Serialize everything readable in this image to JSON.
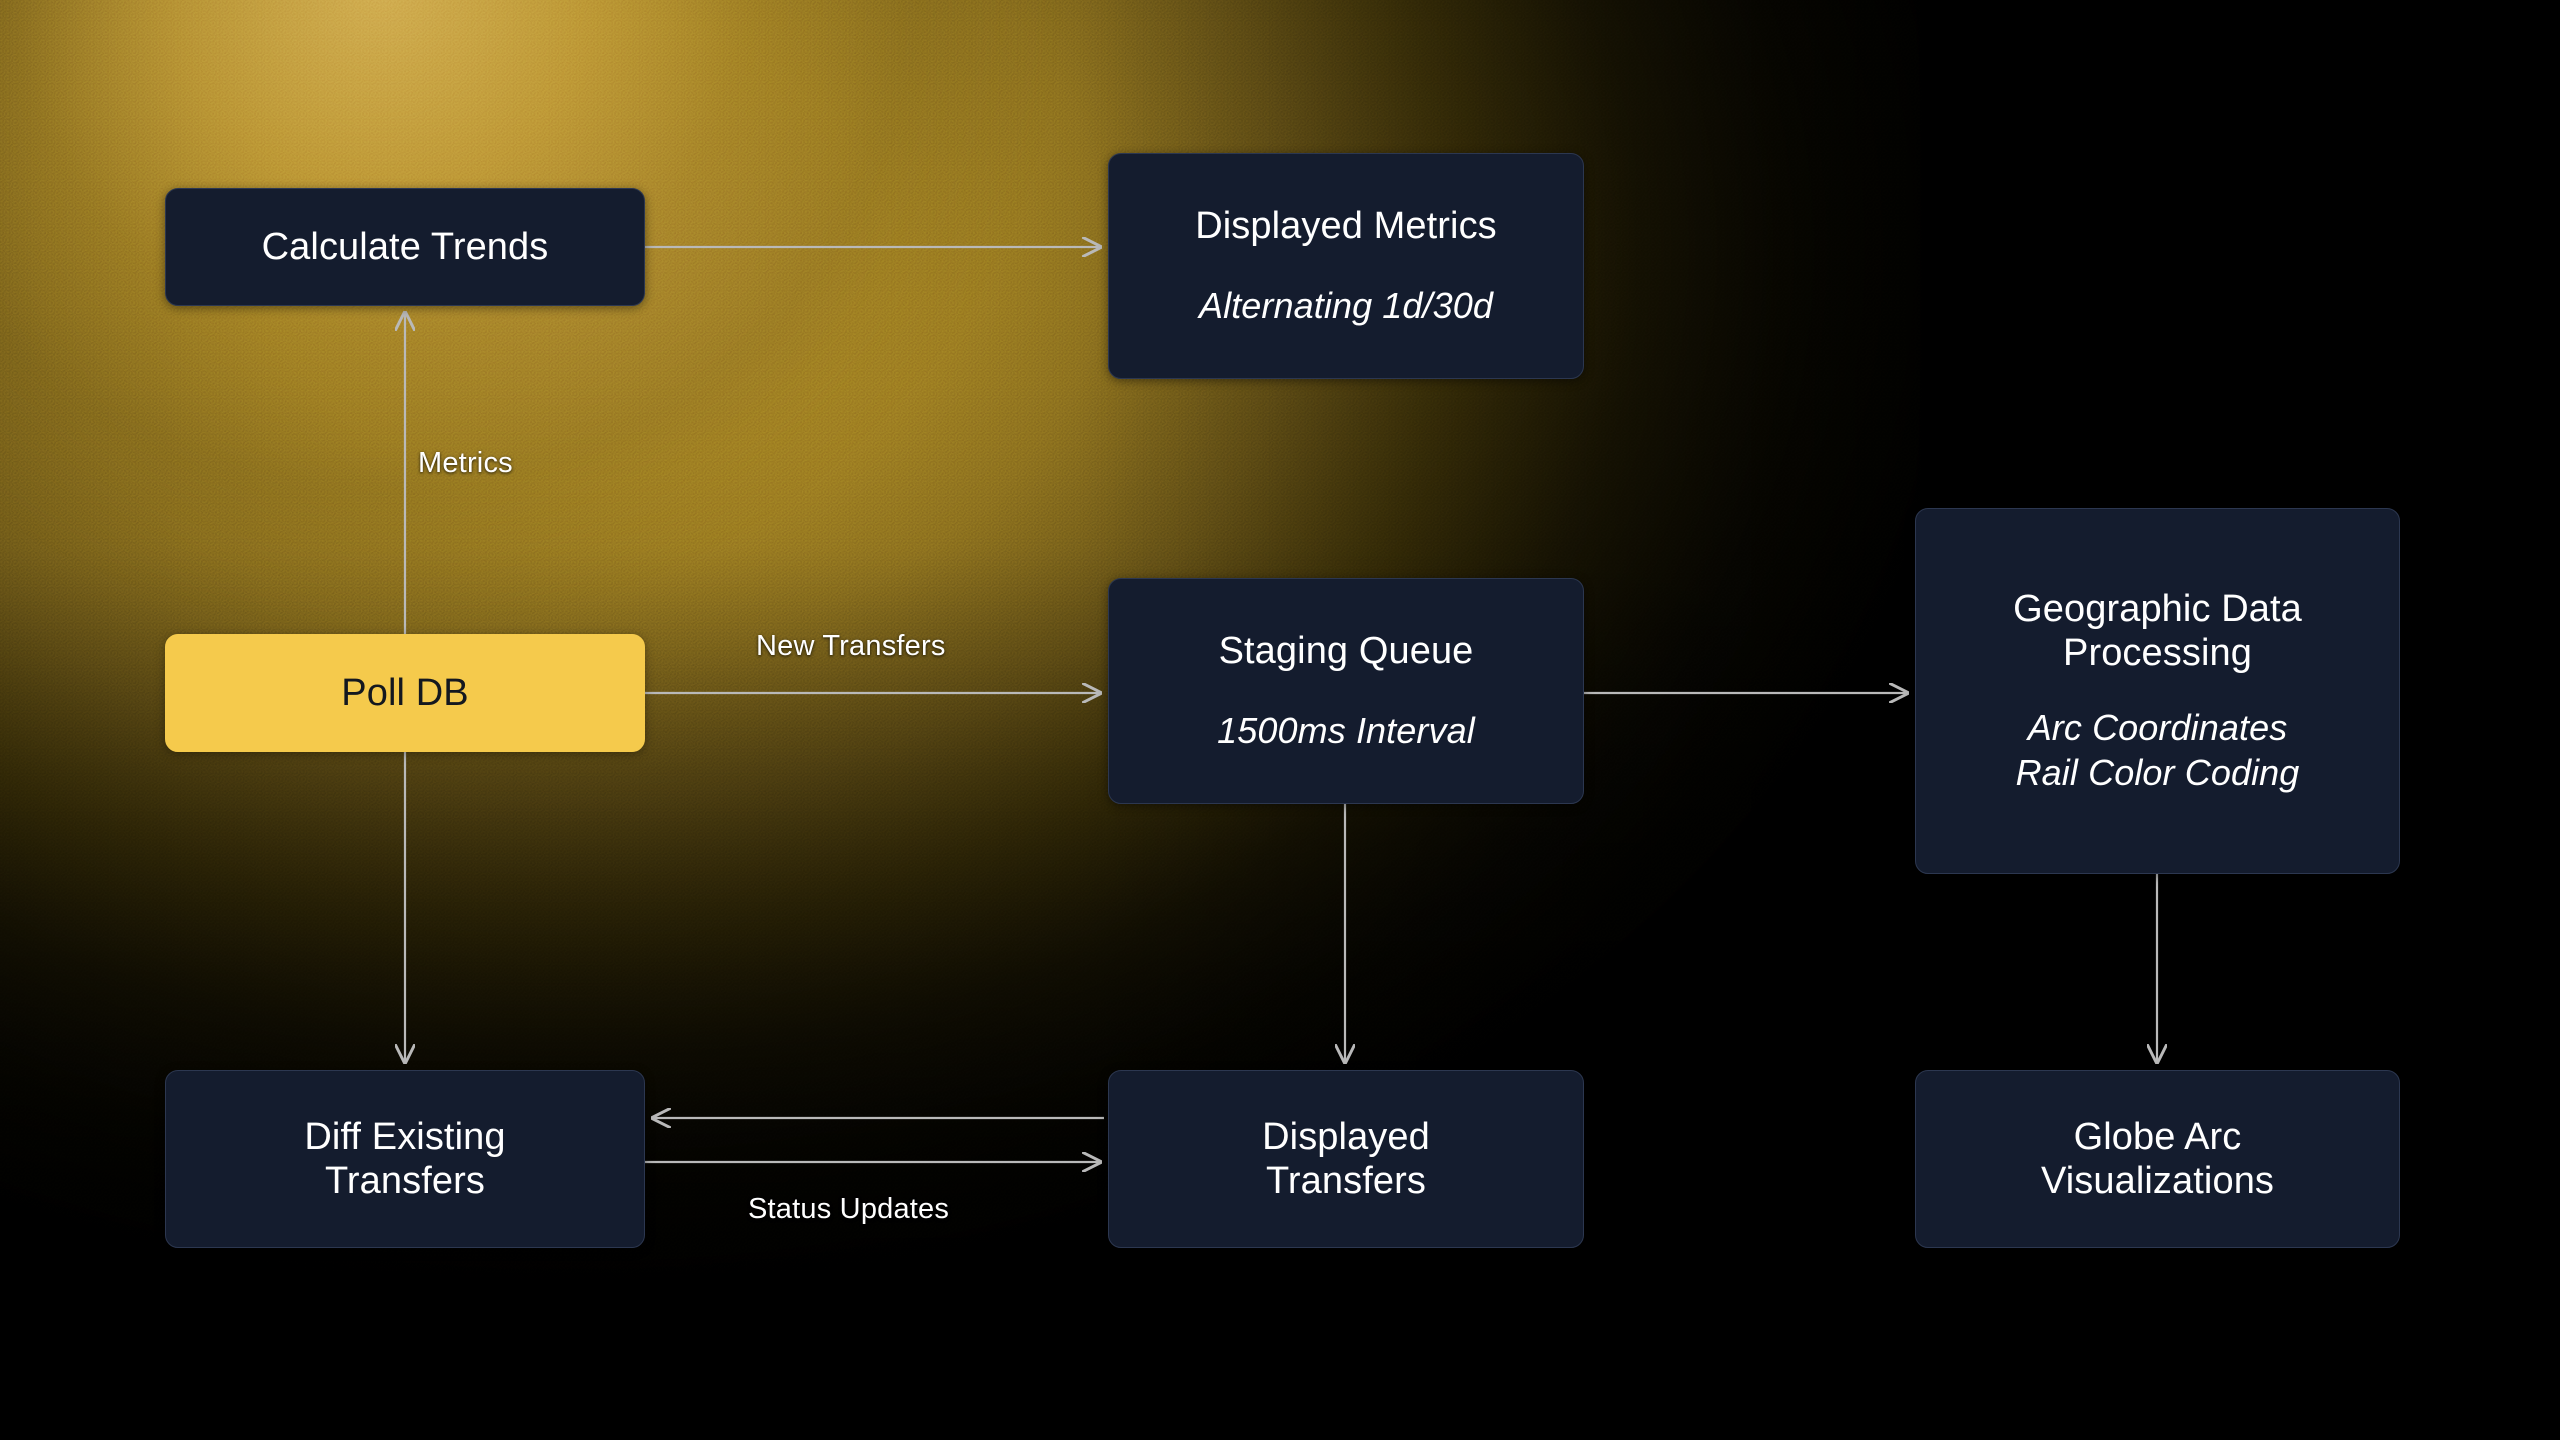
{
  "diagram": {
    "type": "flowchart",
    "background": {
      "base_color": "#000000",
      "glow_color": "#b79233",
      "glow_position": "top-left"
    },
    "palette": {
      "node_fill": "#141c2e",
      "node_border": "#2c3750",
      "node_text": "#ffffff",
      "accent_fill": "#f5ca4c",
      "accent_text": "#14181f",
      "edge_color": "#b9b9b9",
      "label_text": "#ffffff"
    },
    "nodes": [
      {
        "id": "calculate-trends",
        "title": "Calculate Trends",
        "subtitle": "",
        "style": "dark"
      },
      {
        "id": "displayed-metrics",
        "title": "Displayed Metrics",
        "subtitle": "Alternating 1d/30d",
        "style": "dark"
      },
      {
        "id": "poll-db",
        "title": "Poll DB",
        "subtitle": "",
        "style": "accent"
      },
      {
        "id": "staging-queue",
        "title": "Staging Queue",
        "subtitle": "1500ms Interval",
        "style": "dark"
      },
      {
        "id": "geographic-data-processing",
        "title": "Geographic Data\nProcessing",
        "subtitle": "Arc Coordinates\nRail Color Coding",
        "style": "dark"
      },
      {
        "id": "diff-existing-transfers",
        "title": "Diff Existing\nTransfers",
        "subtitle": "",
        "style": "dark"
      },
      {
        "id": "displayed-transfers",
        "title": "Displayed\nTransfers",
        "subtitle": "",
        "style": "dark"
      },
      {
        "id": "globe-arc-visualizations",
        "title": "Globe Arc\nVisualizations",
        "subtitle": "",
        "style": "dark"
      }
    ],
    "edges": [
      {
        "id": "e1",
        "from": "calculate-trends",
        "to": "displayed-metrics",
        "label": "",
        "direction": "right"
      },
      {
        "id": "e2",
        "from": "poll-db",
        "to": "calculate-trends",
        "label": "Metrics",
        "direction": "up"
      },
      {
        "id": "e3",
        "from": "poll-db",
        "to": "staging-queue",
        "label": "New Transfers",
        "direction": "right"
      },
      {
        "id": "e4",
        "from": "poll-db",
        "to": "diff-existing-transfers",
        "label": "",
        "direction": "down"
      },
      {
        "id": "e5",
        "from": "staging-queue",
        "to": "geographic-data-processing",
        "label": "",
        "direction": "right"
      },
      {
        "id": "e6",
        "from": "staging-queue",
        "to": "displayed-transfers",
        "label": "",
        "direction": "down"
      },
      {
        "id": "e7",
        "from": "displayed-transfers",
        "to": "diff-existing-transfers",
        "label": "",
        "direction": "left"
      },
      {
        "id": "e8",
        "from": "diff-existing-transfers",
        "to": "displayed-transfers",
        "label": "Status Updates",
        "direction": "right"
      },
      {
        "id": "e9",
        "from": "geographic-data-processing",
        "to": "globe-arc-visualizations",
        "label": "",
        "direction": "down"
      }
    ],
    "edge_labels": {
      "metrics": "Metrics",
      "new_transfers": "New Transfers",
      "status_updates": "Status Updates"
    }
  }
}
